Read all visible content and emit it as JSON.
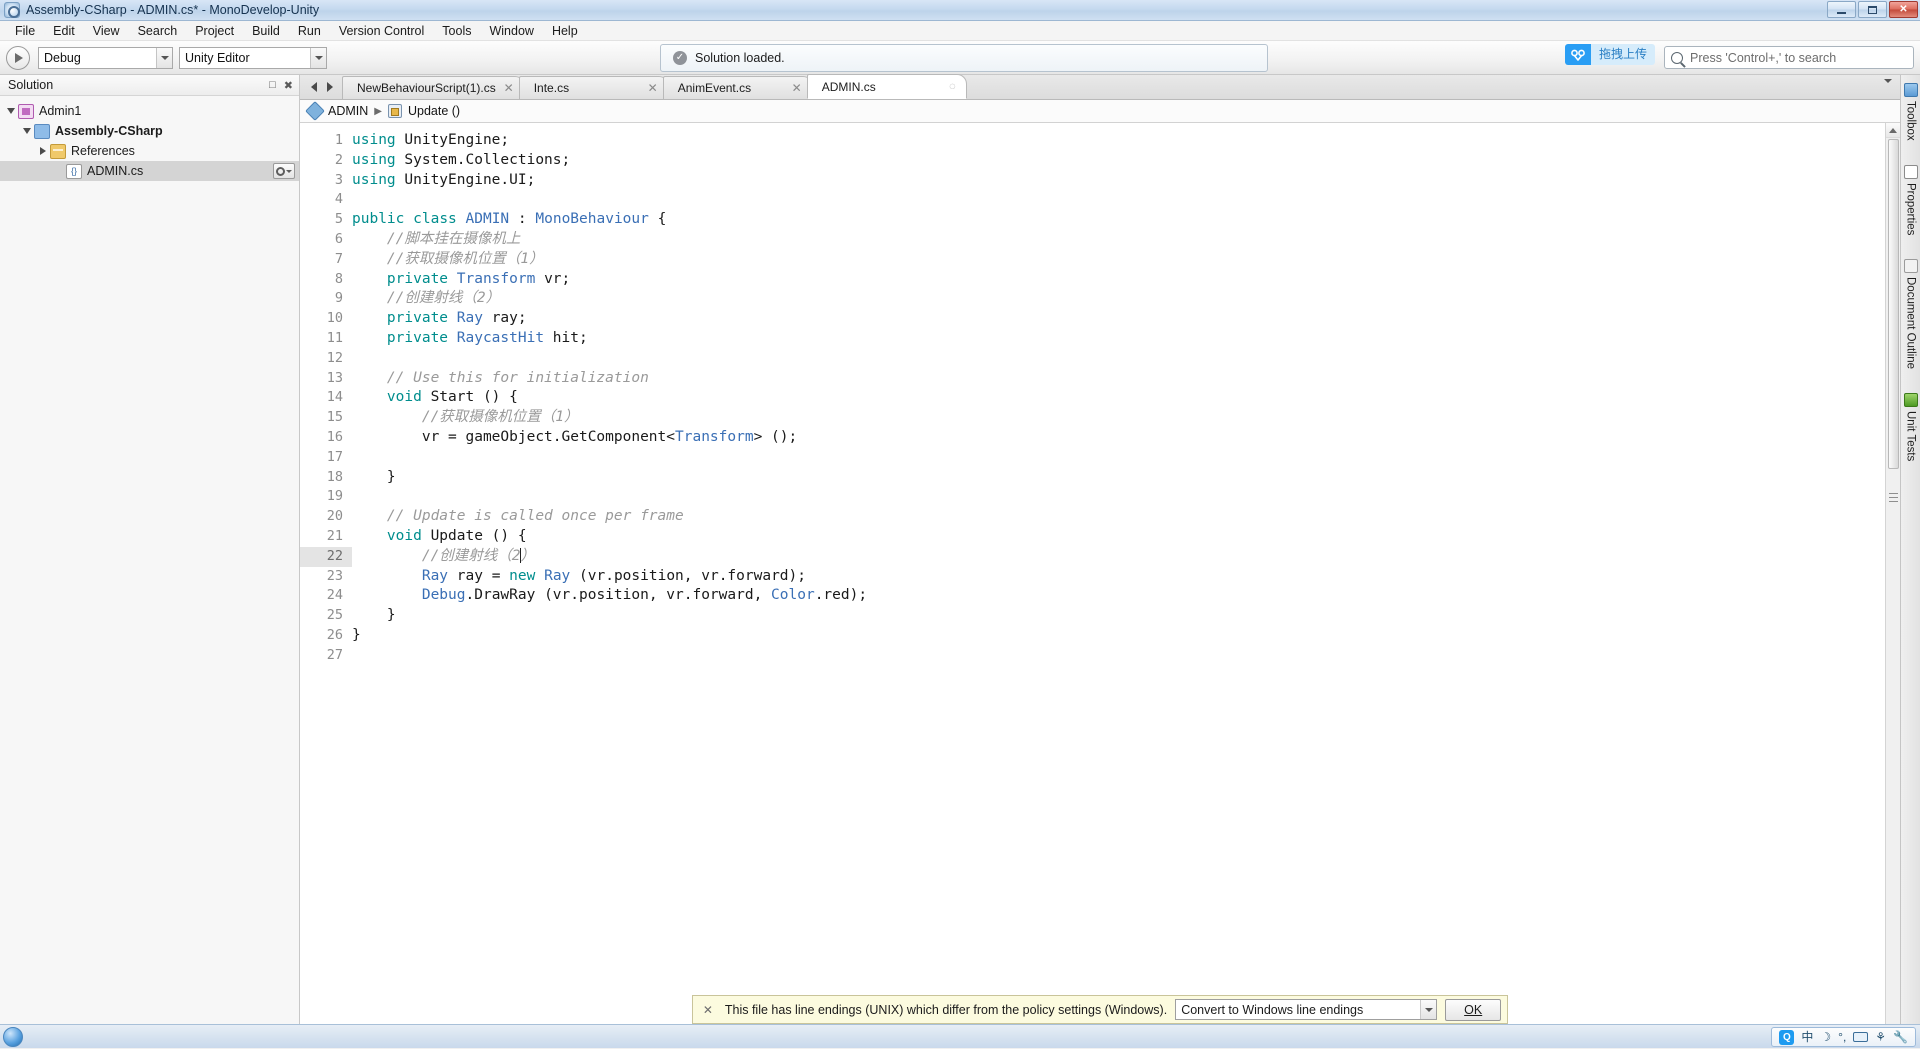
{
  "window": {
    "title": "Assembly-CSharp - ADMIN.cs* - MonoDevelop-Unity",
    "app_icon": "monodevelop-icon",
    "minimize_label": "Minimize",
    "maximize_label": "Restore",
    "close_label": "Close"
  },
  "menubar": {
    "items": [
      {
        "label": "File"
      },
      {
        "label": "Edit"
      },
      {
        "label": "View"
      },
      {
        "label": "Search"
      },
      {
        "label": "Project"
      },
      {
        "label": "Build"
      },
      {
        "label": "Run"
      },
      {
        "label": "Version Control"
      },
      {
        "label": "Tools"
      },
      {
        "label": "Window"
      },
      {
        "label": "Help"
      }
    ]
  },
  "toolbar": {
    "run_button": "run-icon",
    "configuration": {
      "value": "Debug"
    },
    "runtime": {
      "value": "Unity Editor"
    },
    "status": {
      "icon": "check-circle-icon",
      "text": "Solution loaded."
    },
    "upload_chip": {
      "icon": "baidu-netdisk-icon",
      "label": "拖拽上传"
    },
    "search": {
      "icon": "search-icon",
      "placeholder": "Press 'Control+,' to search",
      "value": ""
    }
  },
  "solution_pad": {
    "title": "Solution",
    "minimize_label": "□",
    "close_label": "✖",
    "tree": [
      {
        "label": "Admin1",
        "icon": "solution-icon",
        "indent": 0,
        "expanded": true,
        "bold": false,
        "selected": false
      },
      {
        "label": "Assembly-CSharp",
        "icon": "project-icon",
        "indent": 1,
        "expanded": true,
        "bold": true,
        "selected": false
      },
      {
        "label": "References",
        "icon": "folder-icon",
        "indent": 2,
        "expanded": false,
        "bold": false,
        "selected": false
      },
      {
        "label": "ADMIN.cs",
        "icon": "csharp-file-icon",
        "indent": 3,
        "expanded": null,
        "bold": false,
        "selected": true
      }
    ],
    "row_options_label": "options"
  },
  "editor": {
    "tabs": [
      {
        "label": "NewBehaviourScript(1).cs",
        "active": false,
        "close": "✕"
      },
      {
        "label": "Inte.cs",
        "active": false,
        "close": "✕"
      },
      {
        "label": "AnimEvent.cs",
        "active": false,
        "close": "✕"
      },
      {
        "label": "ADMIN.cs",
        "active": true,
        "close": "◌"
      }
    ],
    "tab_prev": "◀",
    "tab_next": "▶",
    "tab_list": "▾",
    "breadcrumb": {
      "class_icon": "class-icon",
      "class_name": "ADMIN",
      "separator": "▶",
      "member_icon": "method-icon",
      "member_name": "Update ()"
    },
    "current_line": 22,
    "lines": [
      {
        "n": 1,
        "tokens": [
          {
            "t": "using",
            "c": "k"
          },
          {
            "t": " UnityEngine;",
            "c": "pl"
          }
        ]
      },
      {
        "n": 2,
        "tokens": [
          {
            "t": "using",
            "c": "k"
          },
          {
            "t": " System.Collections;",
            "c": "pl"
          }
        ]
      },
      {
        "n": 3,
        "tokens": [
          {
            "t": "using",
            "c": "k"
          },
          {
            "t": " UnityEngine.UI;",
            "c": "pl"
          }
        ]
      },
      {
        "n": 4,
        "tokens": []
      },
      {
        "n": 5,
        "tokens": [
          {
            "t": "public",
            "c": "k"
          },
          {
            "t": " ",
            "c": "pl"
          },
          {
            "t": "class",
            "c": "k"
          },
          {
            "t": " ",
            "c": "pl"
          },
          {
            "t": "ADMIN",
            "c": "ty"
          },
          {
            "t": " : ",
            "c": "pl"
          },
          {
            "t": "MonoBehaviour",
            "c": "ty"
          },
          {
            "t": " {",
            "c": "pl"
          }
        ]
      },
      {
        "n": 6,
        "tokens": [
          {
            "t": "    //脚本挂在摄像机上",
            "c": "cm"
          }
        ]
      },
      {
        "n": 7,
        "tokens": [
          {
            "t": "    //获取摄像机位置（1）",
            "c": "cm"
          }
        ]
      },
      {
        "n": 8,
        "tokens": [
          {
            "t": "    ",
            "c": "pl"
          },
          {
            "t": "private",
            "c": "k"
          },
          {
            "t": " ",
            "c": "pl"
          },
          {
            "t": "Transform",
            "c": "ty"
          },
          {
            "t": " vr;",
            "c": "pl"
          }
        ]
      },
      {
        "n": 9,
        "tokens": [
          {
            "t": "    //创建射线（2）",
            "c": "cm"
          }
        ]
      },
      {
        "n": 10,
        "tokens": [
          {
            "t": "    ",
            "c": "pl"
          },
          {
            "t": "private",
            "c": "k"
          },
          {
            "t": " ",
            "c": "pl"
          },
          {
            "t": "Ray",
            "c": "ty"
          },
          {
            "t": " ray;",
            "c": "pl"
          }
        ]
      },
      {
        "n": 11,
        "tokens": [
          {
            "t": "    ",
            "c": "pl"
          },
          {
            "t": "private",
            "c": "k"
          },
          {
            "t": " ",
            "c": "pl"
          },
          {
            "t": "RaycastHit",
            "c": "ty"
          },
          {
            "t": " hit;",
            "c": "pl"
          }
        ]
      },
      {
        "n": 12,
        "tokens": []
      },
      {
        "n": 13,
        "tokens": [
          {
            "t": "    // Use this for initialization",
            "c": "cm"
          }
        ]
      },
      {
        "n": 14,
        "tokens": [
          {
            "t": "    ",
            "c": "pl"
          },
          {
            "t": "void",
            "c": "k"
          },
          {
            "t": " Start () {",
            "c": "pl"
          }
        ]
      },
      {
        "n": 15,
        "tokens": [
          {
            "t": "        //获取摄像机位置（1）",
            "c": "cm"
          }
        ]
      },
      {
        "n": 16,
        "tokens": [
          {
            "t": "        vr = gameObject.GetComponent<",
            "c": "pl"
          },
          {
            "t": "Transform",
            "c": "ty"
          },
          {
            "t": "> ();",
            "c": "pl"
          }
        ]
      },
      {
        "n": 17,
        "tokens": []
      },
      {
        "n": 18,
        "tokens": [
          {
            "t": "    }",
            "c": "pl"
          }
        ]
      },
      {
        "n": 19,
        "tokens": []
      },
      {
        "n": 20,
        "tokens": [
          {
            "t": "    // Update is called once per frame",
            "c": "cm"
          }
        ]
      },
      {
        "n": 21,
        "tokens": [
          {
            "t": "    ",
            "c": "pl"
          },
          {
            "t": "void",
            "c": "k"
          },
          {
            "t": " Update () {",
            "c": "pl"
          }
        ]
      },
      {
        "n": 22,
        "tokens": [
          {
            "t": "        //创建射线（2",
            "c": "cm"
          },
          {
            "t": "CARET",
            "c": "caret"
          },
          {
            "t": "）",
            "c": "cm"
          }
        ]
      },
      {
        "n": 23,
        "tokens": [
          {
            "t": "        ",
            "c": "pl"
          },
          {
            "t": "Ray",
            "c": "ty"
          },
          {
            "t": " ray = ",
            "c": "pl"
          },
          {
            "t": "new",
            "c": "k"
          },
          {
            "t": " ",
            "c": "pl"
          },
          {
            "t": "Ray",
            "c": "ty"
          },
          {
            "t": " (vr.position, vr.forward);",
            "c": "pl"
          }
        ]
      },
      {
        "n": 24,
        "tokens": [
          {
            "t": "        ",
            "c": "pl"
          },
          {
            "t": "Debug",
            "c": "ty"
          },
          {
            "t": ".DrawRay (vr.position, vr.forward, ",
            "c": "pl"
          },
          {
            "t": "Color",
            "c": "ty"
          },
          {
            "t": ".red);",
            "c": "pl"
          }
        ]
      },
      {
        "n": 25,
        "tokens": [
          {
            "t": "    }",
            "c": "pl"
          }
        ]
      },
      {
        "n": 26,
        "tokens": [
          {
            "t": "}",
            "c": "pl"
          }
        ]
      },
      {
        "n": 27,
        "tokens": []
      }
    ]
  },
  "infobar": {
    "close": "✕",
    "message": "This file has line endings (UNIX) which differ from the policy settings (Windows).",
    "action_value": "Convert to Windows line endings",
    "ok_label": "OK"
  },
  "dock_pads": [
    {
      "label": "Toolbox",
      "icon": "toolbox-icon"
    },
    {
      "label": "Properties",
      "icon": "properties-icon"
    },
    {
      "label": "Document Outline",
      "icon": "document-outline-icon"
    },
    {
      "label": "Unit Tests",
      "icon": "unit-tests-icon"
    }
  ],
  "taskbar": {
    "start_label": "start-orb",
    "ime": {
      "logo": "Q",
      "mode": "中",
      "moon": "☽",
      "punctuation": "°,",
      "keyboard": "keyboard-icon",
      "toolbox": "ime-toolbox-icon",
      "wrench": "wrench-icon"
    }
  },
  "colors": {
    "accent": "#2a9ef4",
    "keyword": "#008d8d",
    "type": "#3a6fb5",
    "comment": "#9a9a9a",
    "infobar_bg": "#fcfbdf"
  }
}
